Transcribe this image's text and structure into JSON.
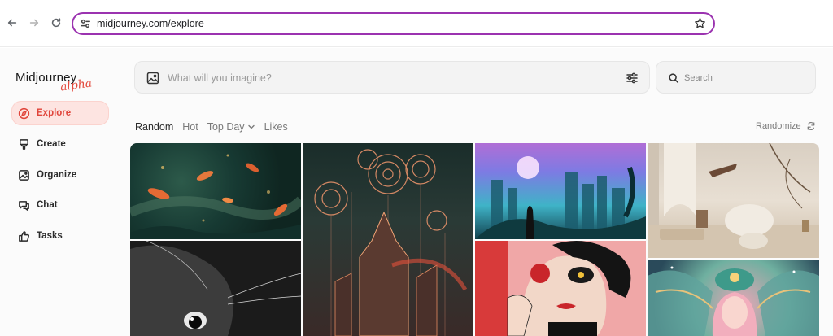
{
  "browser": {
    "url": "midjourney.com/explore"
  },
  "sidebar": {
    "brand": "Midjourney",
    "brand_sub": "alpha",
    "items": [
      {
        "label": "Explore",
        "icon": "compass-icon",
        "active": true
      },
      {
        "label": "Create",
        "icon": "brush-icon",
        "active": false
      },
      {
        "label": "Organize",
        "icon": "image-icon",
        "active": false
      },
      {
        "label": "Chat",
        "icon": "chat-icon",
        "active": false
      },
      {
        "label": "Tasks",
        "icon": "thumbs-up-icon",
        "active": false
      }
    ]
  },
  "imagine": {
    "placeholder": "What will you imagine?"
  },
  "search": {
    "placeholder": "Search"
  },
  "tabs": [
    {
      "label": "Random",
      "active": true
    },
    {
      "label": "Hot",
      "active": false
    },
    {
      "label": "Top Day",
      "active": false,
      "dropdown": true
    },
    {
      "label": "Likes",
      "active": false
    }
  ],
  "randomize_label": "Randomize",
  "gallery": [
    {
      "subject": "koi fish in teal stream"
    },
    {
      "subject": "black cat close-up"
    },
    {
      "subject": "ornate mandala city"
    },
    {
      "subject": "neon city girl silhouette"
    },
    {
      "subject": "stylized face portrait"
    },
    {
      "subject": "minimal white interior"
    },
    {
      "subject": "winged fairy"
    }
  ],
  "colors": {
    "accent": "#e0453b",
    "active_bg": "#fde4e1",
    "url_focus_border": "#9b33b0"
  }
}
